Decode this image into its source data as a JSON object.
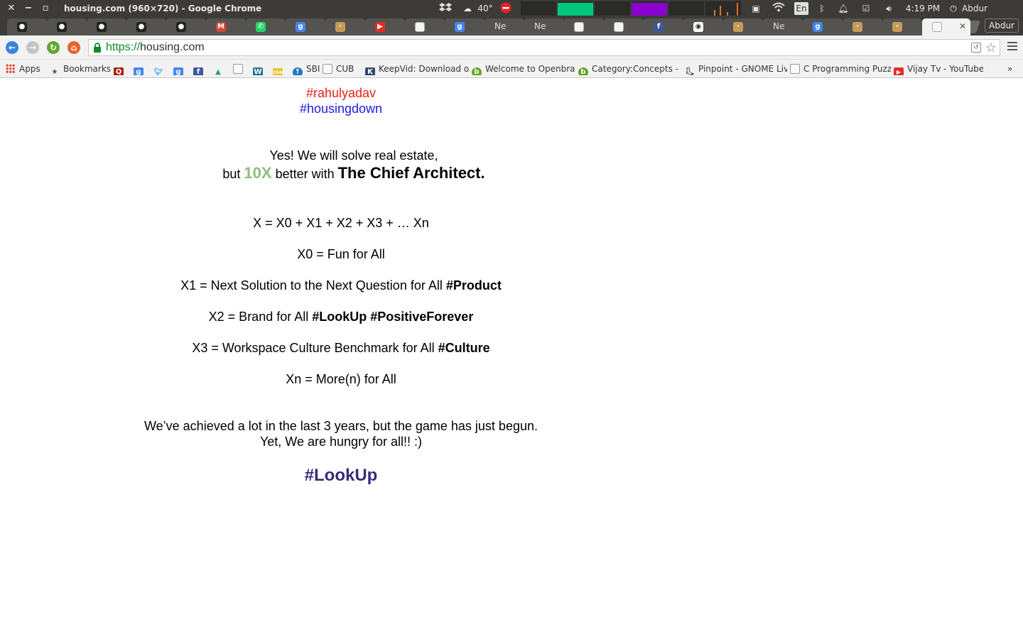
{
  "system_panel": {
    "window_title": "housing.com (960×720) - Google Chrome",
    "temperature": "40°",
    "keyboard_layout": "En",
    "clock": "4:19 PM",
    "user": "Abdur Rahman"
  },
  "tabs": [
    {
      "label": "",
      "icon": "github-icon"
    },
    {
      "label": "",
      "icon": "github-icon"
    },
    {
      "label": "",
      "icon": "github-icon"
    },
    {
      "label": "",
      "icon": "github-icon"
    },
    {
      "label": "",
      "icon": "github-icon"
    },
    {
      "label": "",
      "icon": "gmail-icon"
    },
    {
      "label": "",
      "icon": "whatsapp-icon"
    },
    {
      "label": "",
      "icon": "google-icon"
    },
    {
      "label": "",
      "icon": "page-icon"
    },
    {
      "label": "",
      "icon": "youtube-icon"
    },
    {
      "label": "",
      "icon": "document-icon"
    },
    {
      "label": "",
      "icon": "google-icon"
    },
    {
      "label": "Ne",
      "icon": ""
    },
    {
      "label": "Ne",
      "icon": ""
    },
    {
      "label": "",
      "icon": "document-icon"
    },
    {
      "label": "",
      "icon": "document-icon"
    },
    {
      "label": "",
      "icon": "facebook-icon"
    },
    {
      "label": "",
      "icon": "reddit-icon"
    },
    {
      "label": "",
      "icon": "page-icon"
    },
    {
      "label": "Ne",
      "icon": ""
    },
    {
      "label": "",
      "icon": "google-icon"
    },
    {
      "label": "",
      "icon": "page-icon"
    },
    {
      "label": "",
      "icon": "page-icon"
    },
    {
      "label": "",
      "icon": "document-icon",
      "active": true
    }
  ],
  "profile_button": "Abdur",
  "omnibox": {
    "scheme": "https://",
    "host": "housing.com"
  },
  "bookmarks": [
    {
      "label": "Apps",
      "icon": "apps-icon"
    },
    {
      "label": "Bookmarks",
      "icon": "star-icon"
    },
    {
      "label": "",
      "icon": "quora-icon"
    },
    {
      "label": "",
      "icon": "google-icon"
    },
    {
      "label": "",
      "icon": "twitter-icon"
    },
    {
      "label": "",
      "icon": "google-icon"
    },
    {
      "label": "",
      "icon": "facebook-icon"
    },
    {
      "label": "",
      "icon": "drive-icon"
    },
    {
      "label": "",
      "icon": "document-icon"
    },
    {
      "label": "",
      "icon": "wordpress-icon"
    },
    {
      "label": "",
      "icon": "2048-icon"
    },
    {
      "label": "SBI",
      "icon": "sbi-icon"
    },
    {
      "label": "CUB",
      "icon": "document-icon"
    },
    {
      "label": "KeepVid: Download o",
      "icon": "keepvid-icon"
    },
    {
      "label": "Welcome to Openbra",
      "icon": "openbravo-icon"
    },
    {
      "label": "Category:Concepts - (",
      "icon": "openbravo-icon"
    },
    {
      "label": "Pinpoint - GNOME Liv",
      "icon": "gnome-icon"
    },
    {
      "label": "C Programming Puzzl",
      "icon": "document-icon"
    },
    {
      "label": "Vijay Tv - YouTube",
      "icon": "youtube-icon"
    }
  ],
  "bookmarks_overflow": "»",
  "page": {
    "tag1": "#rahulyadav",
    "tag2": "#housingdown",
    "intro_line1": "Yes! We will solve real estate,",
    "intro_but": "but ",
    "intro_10x": "10X",
    "intro_better": " better with ",
    "intro_chief": "The Chief Architect.",
    "formula": "X = X0 + X1 + X2 + X3 + … Xn",
    "x0": "X0 = Fun for All",
    "x1_text": "X1 = Next Solution to the Next Question for All ",
    "x1_tag": "#Product",
    "x2_text": "X2 = Brand for All ",
    "x2_tag": "#LookUp #PositiveForever",
    "x3_text": "X3 = Workspace Culture Benchmark for All ",
    "x3_tag": "#Culture",
    "xn": "Xn = More(n) for All",
    "outro_line1": "We’ve achieved a lot in the last 3 years, but the game has just begun.",
    "outro_line2": "Yet, We are hungry for all!! :)",
    "final_tag": "#LookUp"
  },
  "colors": {
    "tag_red": "#e62117",
    "tag_blue": "#1a1ae6",
    "tenx_green": "#8fbf75",
    "lookup_purple": "#3b2a7a"
  }
}
